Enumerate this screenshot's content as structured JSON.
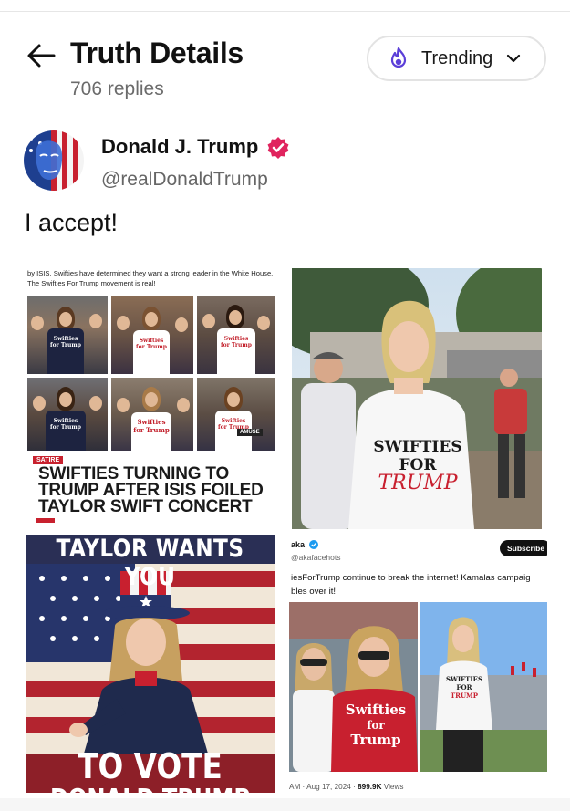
{
  "header": {
    "title": "Truth Details",
    "replies": "706 replies",
    "sort_label": "Trending"
  },
  "post": {
    "author_name": "Donald J. Trump",
    "author_handle": "@realDonaldTrump",
    "text": "I accept!"
  },
  "media": {
    "tile1": {
      "caption": "by ISIS, Swifties have determined they want a strong leader in the White House. The Swifties For Trump movement is real!",
      "badge": "SATIRE",
      "headline": "SWIFTIES TURNING TO TRUMP AFTER ISIS FOILED TAYLOR SWIFT CONCERT",
      "shirt_line1": "Swifties",
      "shirt_line2": "for Trump",
      "watermark": "AMUSE"
    },
    "tile2": {
      "shirt_line1": "SWIFTIES",
      "shirt_line2": "FOR",
      "shirt_line3": "TRUMP"
    },
    "tile3": {
      "top_text": "TAYLOR WANTS YOU",
      "bottom_text": "TO VOTE FOR",
      "bottom_text2": "DONALD TRUMP"
    },
    "tile4": {
      "name": "aka",
      "handle": "@akafacehots",
      "subscribe": "Subscribe",
      "text_line1": "iesForTrump continue to break the internet! Kamalas campaig",
      "text_line2": "bles over it!",
      "meta_time": "AM · Aug 17, 2024 · ",
      "meta_views": "899.9K",
      "meta_views_label": " Views",
      "shirt_line1": "Swifties",
      "shirt_line2": "for",
      "shirt_line3": "Trump",
      "shirt2_line1": "SWIFTIES",
      "shirt2_line2": "FOR",
      "shirt2_line3": "TRUMP"
    }
  },
  "colors": {
    "accent_purple": "#5b3fd8",
    "verified_badge": "#e0245e",
    "satire_red": "#c8212e"
  },
  "icons": {
    "back": "arrow-left-icon",
    "trending": "flame-icon",
    "dropdown": "chevron-down-icon",
    "verified": "verified-badge-icon"
  }
}
